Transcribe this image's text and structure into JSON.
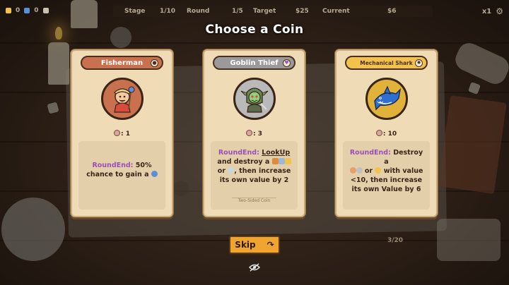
{
  "hud": {
    "coins_a": "0",
    "coins_b": "0",
    "stage_label": "Stage",
    "stage_value": "1/10",
    "round_label": "Round",
    "round_value": "1/5",
    "target_label": "Target",
    "target_value": "$25",
    "current_label": "Current",
    "current_value": "$6",
    "speed": "x1"
  },
  "title": "Choose a Coin",
  "cards": [
    {
      "name": "Fisherman",
      "banner_color": "#c9704e",
      "portrait_bg": "#c9704e",
      "value": "1",
      "desc_keyword": "RoundEnd:",
      "desc_text": " 50% chance to gain a"
    },
    {
      "name": "Goblin Thief",
      "banner_color": "#9a9a9a",
      "portrait_bg": "#b9b9b9",
      "value": "3",
      "desc_keyword": "RoundEnd:",
      "desc_link": "LookUp",
      "desc_text_1": "and destroy a",
      "desc_text_2": "or",
      "desc_text_3": ", then increase its own value by 2",
      "footnote": "Two-Sided Coin"
    },
    {
      "name": "Mechanical Shark",
      "banner_color": "#f2c24c",
      "portrait_bg": "#e0b23a",
      "value": "10",
      "desc_keyword": "RoundEnd:",
      "desc_text_1": "Destroy a",
      "desc_text_2": "or",
      "desc_text_3": "with value <10, then increase its own Value by 6"
    }
  ],
  "skip_label": "Skip",
  "deck_count": "3/20",
  "icons": {
    "banner_badges": [
      "coin-type-icon",
      "shield-icon",
      "gear-icon"
    ],
    "hide": "eye-slash-icon",
    "settings": "gear-icon",
    "skip_arrow": "curved-arrow-icon"
  }
}
